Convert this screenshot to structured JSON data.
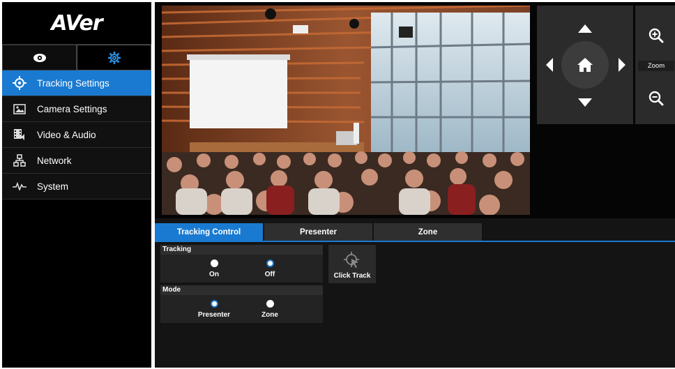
{
  "brand": {
    "logo_text": "AVer"
  },
  "mode_tabs": [
    {
      "icon": "eye-icon",
      "active": false
    },
    {
      "icon": "gear-icon",
      "active": true
    }
  ],
  "nav": [
    {
      "label": "Tracking Settings",
      "icon": "target-icon",
      "active": true
    },
    {
      "label": "Camera Settings",
      "icon": "image-icon",
      "active": false
    },
    {
      "label": "Video & Audio",
      "icon": "film-audio-icon",
      "active": false
    },
    {
      "label": "Network",
      "icon": "network-icon",
      "active": false
    },
    {
      "label": "System",
      "icon": "pulse-icon",
      "active": false
    }
  ],
  "ptz": {
    "up_icon": "arrow-up-icon",
    "down_icon": "arrow-down-icon",
    "left_icon": "arrow-left-icon",
    "right_icon": "arrow-right-icon",
    "home_icon": "home-icon"
  },
  "zoom": {
    "label": "Zoom",
    "in_icon": "zoom-in-icon",
    "out_icon": "zoom-out-icon"
  },
  "tabs": [
    {
      "label": "Tracking Control",
      "active": true
    },
    {
      "label": "Presenter",
      "active": false
    },
    {
      "label": "Zone",
      "active": false
    }
  ],
  "tracking": {
    "heading": "Tracking",
    "options": [
      {
        "label": "On",
        "selected": false
      },
      {
        "label": "Off",
        "selected": true
      }
    ]
  },
  "mode": {
    "heading": "Mode",
    "options": [
      {
        "label": "Presenter",
        "selected": true
      },
      {
        "label": "Zone",
        "selected": false
      }
    ]
  },
  "click_track": {
    "label": "Click Track",
    "icon": "click-track-icon"
  },
  "colors": {
    "accent": "#1a7ad1",
    "background": "#141414",
    "panel": "#2e2e2e"
  }
}
